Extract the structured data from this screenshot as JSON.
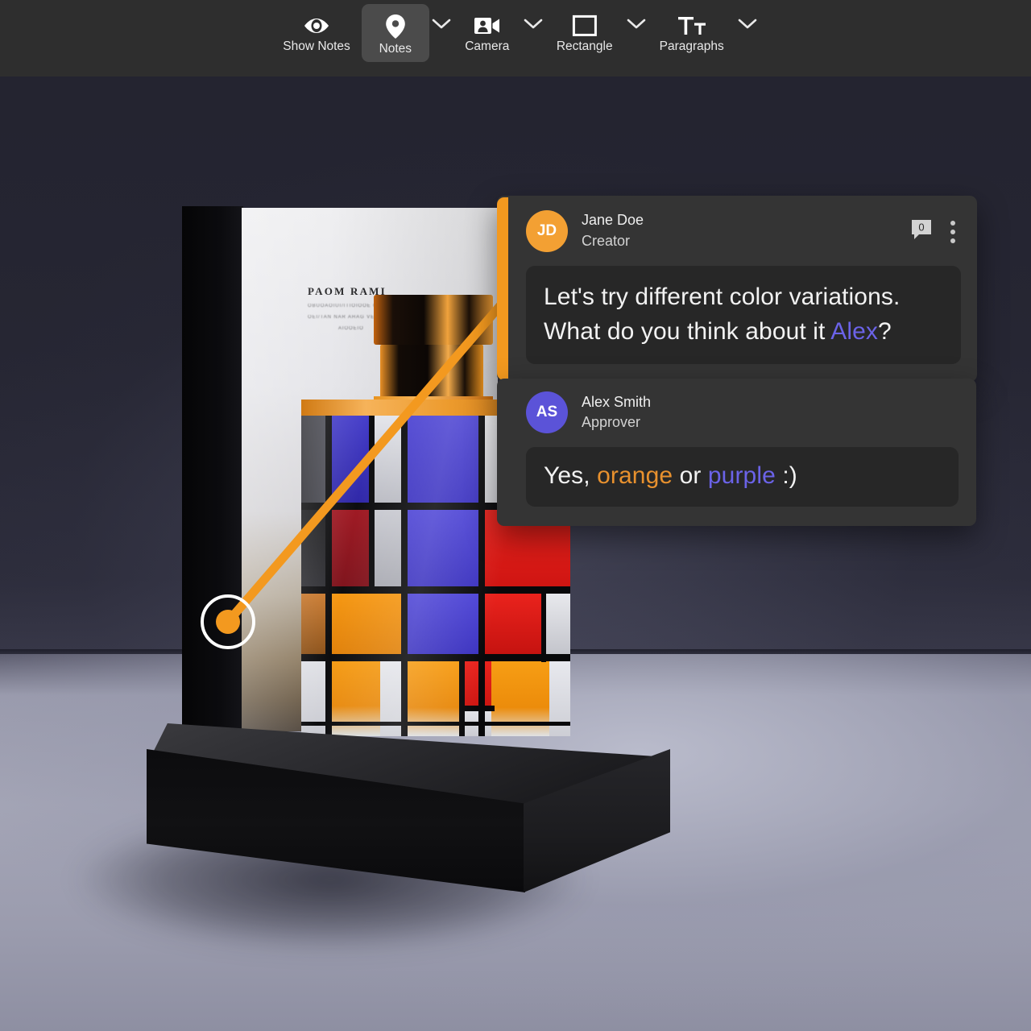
{
  "toolbar": {
    "items": [
      {
        "label": "Show Notes",
        "icon": "eye-icon",
        "active": false,
        "has_caret": false
      },
      {
        "label": "Notes",
        "icon": "map-pin-icon",
        "active": true,
        "has_caret": true
      },
      {
        "label": "Camera",
        "icon": "camera-person-icon",
        "active": false,
        "has_caret": true
      },
      {
        "label": "Rectangle",
        "icon": "rectangle-icon",
        "active": false,
        "has_caret": true
      },
      {
        "label": "Paragraphs",
        "icon": "text-size-icon",
        "active": false,
        "has_caret": true
      }
    ],
    "background_color": "#2e2e2e",
    "active_background_color": "#4b4b4b"
  },
  "annotation": {
    "pin_label": "annotation-pin",
    "accent_color": "#f3991f",
    "connector_color": "#f3991f"
  },
  "comments": [
    {
      "avatar_initials": "JD",
      "avatar_color": "#f3a033",
      "author": "Jane Doe",
      "role": "Creator",
      "reply_count": "0",
      "message_parts": [
        {
          "text": "Let's try different color variations. What do you think about it ",
          "style": "plain"
        },
        {
          "text": "Alex",
          "style": "mention"
        },
        {
          "text": "?",
          "style": "plain"
        }
      ]
    },
    {
      "avatar_initials": "AS",
      "avatar_color": "#5b53d8",
      "author": "Alex Smith",
      "role": "Approver",
      "message_parts": [
        {
          "text": "Yes, ",
          "style": "plain"
        },
        {
          "text": "orange",
          "style": "orange"
        },
        {
          "text": " or ",
          "style": "plain"
        },
        {
          "text": "purple",
          "style": "purple"
        },
        {
          "text": " :)",
          "style": "plain"
        }
      ]
    }
  ],
  "artwork": {
    "card_title": "PAOM RAMI",
    "card_sub1": "OBUOAOIUI/ITIOIOOE 07",
    "card_sub2": "OEI/TAN NAR AHAG VEB T'I/",
    "card_sub3": "AIOOEIO",
    "palette": {
      "orange": "#f28b12",
      "blue": "#3b32bb",
      "red": "#e01a17",
      "clear": "#d9dade",
      "cap_orange": "#e8911f",
      "grid_black": "#08080a"
    }
  }
}
